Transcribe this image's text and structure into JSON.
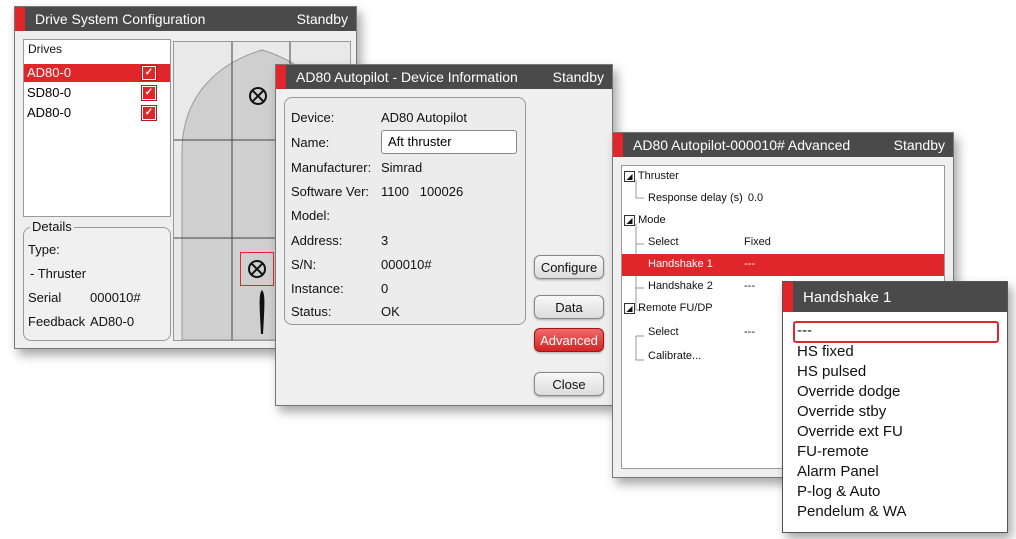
{
  "drive_win": {
    "title": "Drive System Configuration",
    "status": "Standby",
    "drives_header": "Drives",
    "drives": [
      {
        "name": "AD80-0",
        "checked": true
      },
      {
        "name": "SD80-0",
        "checked": true
      },
      {
        "name": "AD80-0",
        "checked": true
      }
    ],
    "details": {
      "legend": "Details",
      "type_label": "Type:",
      "type_value": "- Thruster",
      "serial_label": "Serial",
      "serial_value": "000010#",
      "feedback_label": "Feedback",
      "feedback_value": "AD80-0"
    }
  },
  "device_win": {
    "title": "AD80 Autopilot - Device Information",
    "status": "Standby",
    "fields": {
      "device_label": "Device:",
      "device_value": "AD80 Autopilot",
      "name_label": "Name:",
      "name_value": "Aft thruster",
      "manufacturer_label": "Manufacturer:",
      "manufacturer_value": "Simrad",
      "software_label": "Software Ver:",
      "software_value": "1100   100026",
      "model_label": "Model:",
      "address_label": "Address:",
      "address_value": "3",
      "sn_label": "S/N:",
      "sn_value": "000010#",
      "instance_label": "Instance:",
      "instance_value": "0",
      "status_label": "Status:",
      "status_value": "OK"
    },
    "buttons": {
      "configure": "Configure",
      "data": "Data",
      "advanced": "Advanced",
      "close": "Close"
    }
  },
  "adv_win": {
    "title": "AD80 Autopilot-000010# Advanced",
    "status": "Standby",
    "tree": {
      "thruster": "Thruster",
      "response_delay": "Response delay (s)",
      "response_delay_value": "0.0",
      "mode": "Mode",
      "select": "Select",
      "select_value": "Fixed",
      "handshake1": "Handshake 1",
      "handshake1_value": "---",
      "handshake2": "Handshake 2",
      "handshake2_value": "---",
      "remote": "Remote FU/DP",
      "remote_select": "Select",
      "remote_select_value": "---",
      "calibrate": "Calibrate..."
    }
  },
  "handshake_popup": {
    "title": "Handshake 1",
    "options": [
      "---",
      "HS fixed",
      "HS pulsed",
      "Override dodge",
      "Override stby",
      "Override ext FU",
      "FU-remote",
      "Alarm Panel",
      "P-log & Auto",
      "Pendelum & WA"
    ],
    "selected_index": 0
  },
  "colors": {
    "accent": "#e0262a",
    "titlebar": "#4a4a4a",
    "window": "#efefef"
  }
}
